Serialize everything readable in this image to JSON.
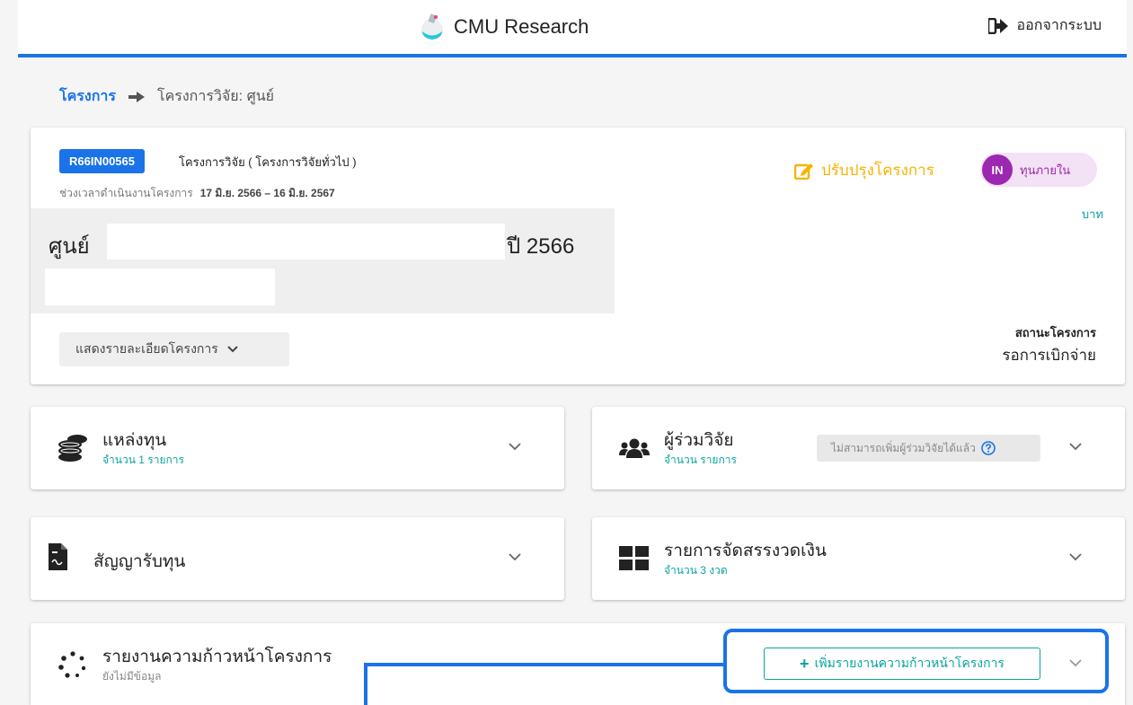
{
  "header": {
    "app_name": "CMU Research",
    "logout_label": "ออกจากระบบ"
  },
  "breadcrumb": {
    "root": "โครงการ",
    "current": "โครงการวิจัย: ศูนย์"
  },
  "project": {
    "code": "R66IN00565",
    "type": "โครงการวิจัย ( โครงการวิจัยทั่วไป )",
    "period_label": "ช่วงเวลาดำเนินงานโครงการ",
    "period_value": "17 มิ.ย. 2566 – 16 มิ.ย. 2567",
    "title": "ศูนย์",
    "year": "ปี 2566",
    "detail_button": "แสดงรายละเอียดโครงการ",
    "edit_button": "ปรับปรุงโครงการ",
    "fund_badge": "IN",
    "fund_label": "ทุนภายใน",
    "currency": "บาท",
    "status_label": "สถานะโครงการ",
    "status_value": "รอการเบิกจ่าย"
  },
  "sections": {
    "funding": {
      "title": "แหล่งทุน",
      "subtitle": "จำนวน 1 รายการ"
    },
    "coresearch": {
      "title": "ผู้ร่วมวิจัย",
      "subtitle": "จำนวน   รายการ",
      "note": "ไม่สามารถเพิ่มผู้ร่วมวิจัยได้แล้ว"
    },
    "contract": {
      "title": "สัญญารับทุน"
    },
    "installments": {
      "title": "รายการจัดสรรงวดเงิน",
      "subtitle": "จำนวน 3 งวด"
    },
    "progress": {
      "title": "รายงานความก้าวหน้าโครงการ",
      "subtitle": "ยังไม่มีข้อมูล",
      "add_button": "เพิ่มรายงานความก้าวหน้าโครงการ"
    }
  },
  "colors": {
    "primary": "#1a73e8",
    "accent_teal": "#0aa3a0",
    "warning": "#f5b400",
    "fund_purple": "#9c27b0"
  }
}
